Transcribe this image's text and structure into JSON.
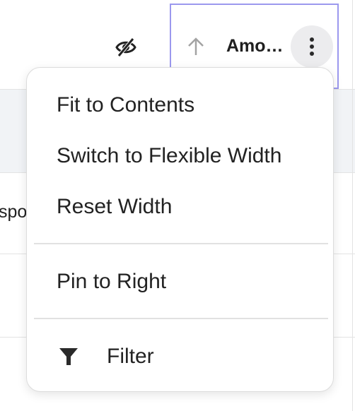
{
  "grid": {
    "partial_cell_text": "spor",
    "column_title": "Amo…",
    "icons": {
      "hidden": "eye-off-icon",
      "sort": "arrow-up-icon",
      "menu": "more-vertical-icon"
    }
  },
  "context_menu": {
    "items": [
      {
        "label": "Fit to Contents"
      },
      {
        "label": "Switch to Flexible Width"
      },
      {
        "label": "Reset Width"
      },
      {
        "label": "Pin to Right"
      },
      {
        "label": "Filter",
        "icon": "filter-icon"
      }
    ]
  },
  "colors": {
    "selection_border": "#9b98ee",
    "row_highlight": "#f1f3f6",
    "menu_button_bg": "#ececee"
  }
}
